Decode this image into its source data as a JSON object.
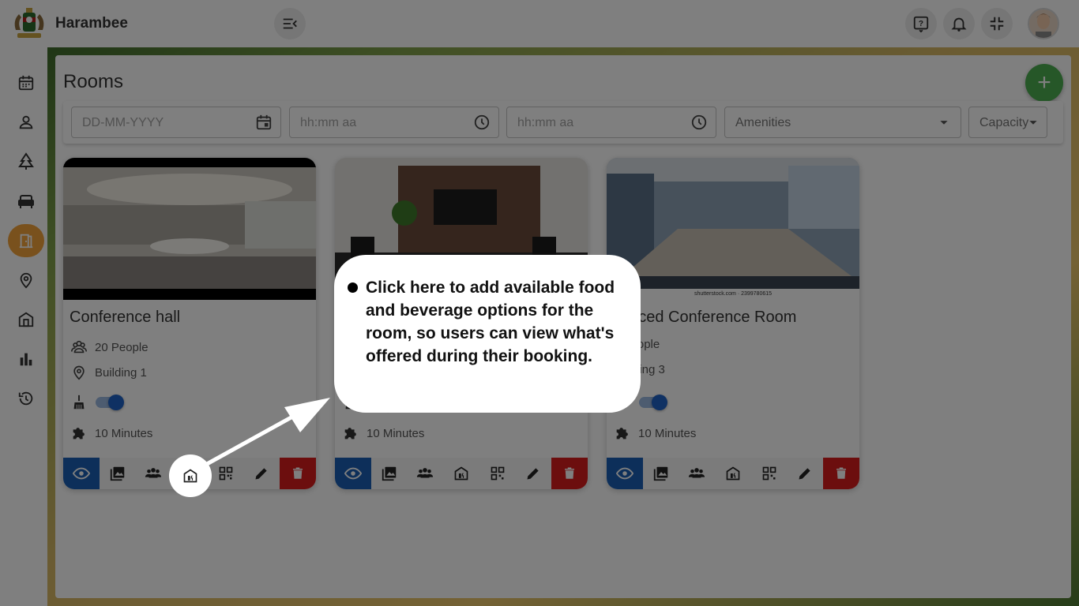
{
  "app": {
    "name": "Harambee"
  },
  "header": {
    "menu_icon": "menu-collapse-icon",
    "help_icon": "help-icon",
    "bell_icon": "notification-bell-icon",
    "fullscreen_icon": "exit-fullscreen-icon"
  },
  "sidebar": {
    "items": [
      {
        "icon": "calendar-icon"
      },
      {
        "icon": "person-icon"
      },
      {
        "icon": "tree-icon"
      },
      {
        "icon": "sofa-icon"
      },
      {
        "icon": "door-icon",
        "active": true
      },
      {
        "icon": "location-pin-icon"
      },
      {
        "icon": "building-icon"
      },
      {
        "icon": "bar-chart-icon"
      },
      {
        "icon": "history-icon"
      }
    ]
  },
  "page": {
    "title": "Rooms",
    "add_label": "+"
  },
  "filters": {
    "date_placeholder": "DD-MM-YYYY",
    "start_time_placeholder": "hh:mm aa",
    "end_time_placeholder": "hh:mm aa",
    "amenities_placeholder": "Amenities",
    "capacity_placeholder": "Capacity"
  },
  "rooms": [
    {
      "name": "Conference hall",
      "capacity": "20 People",
      "location": "Building 1",
      "cleaning_enabled": true,
      "duration": "10 Minutes"
    },
    {
      "name": "",
      "capacity": "",
      "location": "",
      "cleaning_enabled": true,
      "duration": "10 Minutes"
    },
    {
      "name": "vanced Conference Room",
      "capacity": "0 People",
      "location": "Building 3",
      "cleaning_enabled": true,
      "duration": "10 Minutes",
      "image_caption": "shutterstock.com · 2399780615"
    }
  ],
  "tooltip": {
    "text": "Click here to add available food and beverage options for the room, so users can view what's offered during their booking."
  },
  "colors": {
    "accent_green": "#4caf50",
    "active_nav": "#f2a33a",
    "view_button": "#1a5fb4",
    "delete_button": "#d81c1c",
    "toggle": "#1e63c6"
  }
}
